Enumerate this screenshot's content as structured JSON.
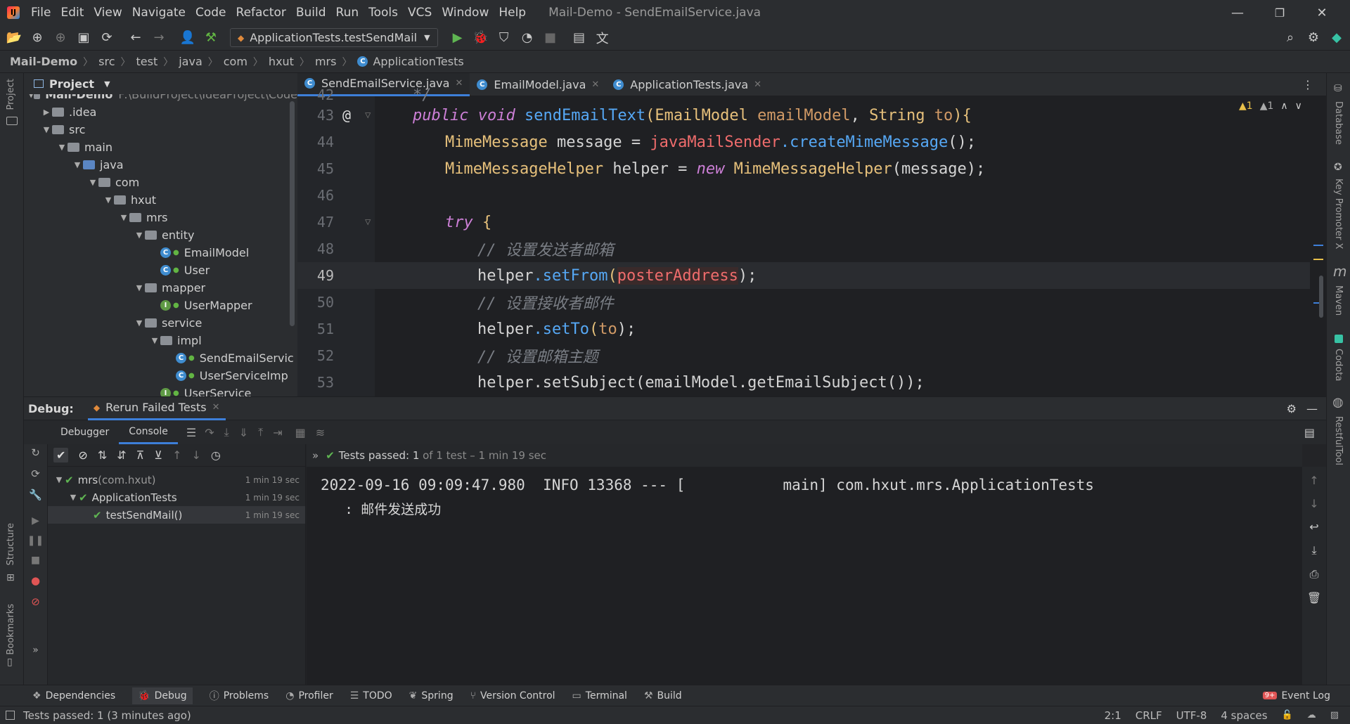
{
  "menu": {
    "items": [
      "File",
      "Edit",
      "View",
      "Navigate",
      "Code",
      "Refactor",
      "Build",
      "Run",
      "Tools",
      "VCS",
      "Window",
      "Help"
    ],
    "window_title": "Mail-Demo - SendEmailService.java"
  },
  "toolbar": {
    "run_config": "ApplicationTests.testSendMail"
  },
  "breadcrumb": [
    "Mail-Demo",
    "src",
    "test",
    "java",
    "com",
    "hxut",
    "mrs",
    "ApplicationTests"
  ],
  "left_strip": {
    "project": "Project",
    "structure": "Structure",
    "bookmarks": "Bookmarks"
  },
  "right_strip": {
    "database": "Database",
    "key_promoter": "Key Promoter X",
    "maven": "Maven",
    "codota": "Codota",
    "restful": "RestfulTool"
  },
  "project": {
    "header": "Project",
    "root_name": "Mail-Demo",
    "root_path": "F:\\BuildProject\\IdeaProject\\Code",
    "tree": [
      {
        "label": ".idea"
      },
      {
        "label": "src"
      },
      {
        "label": "main"
      },
      {
        "label": "java"
      },
      {
        "label": "com"
      },
      {
        "label": "hxut"
      },
      {
        "label": "mrs"
      },
      {
        "label": "entity"
      },
      {
        "label": "EmailModel"
      },
      {
        "label": "User"
      },
      {
        "label": "mapper"
      },
      {
        "label": "UserMapper"
      },
      {
        "label": "service"
      },
      {
        "label": "impl"
      },
      {
        "label": "SendEmailServic"
      },
      {
        "label": "UserServiceImp"
      },
      {
        "label": "UserService"
      }
    ]
  },
  "editor": {
    "tabs": [
      "SendEmailService.java",
      "EmailModel.java",
      "ApplicationTests.java"
    ],
    "warnings": "▲1",
    "weak_warnings": "▲1",
    "line_numbers": [
      "42",
      "43",
      "44",
      "45",
      "46",
      "47",
      "48",
      "49",
      "50",
      "51",
      "52",
      "53"
    ],
    "lines": {
      "l42": "*/",
      "l43": {
        "kw1": "public",
        "kw2": "void",
        "fn": "sendEmailText",
        "p1": "(",
        "t1": "EmailModel",
        "v1": " emailModel",
        "c1": ", ",
        "t2": "String",
        "v2": " to",
        "p2": "){"
      },
      "l44": {
        "t": "MimeMessage",
        "v": " message = ",
        "f": "javaMailSender",
        "m": ".createMimeMessage",
        "e": "();"
      },
      "l45": {
        "t": "MimeMessageHelper",
        "v": " helper = ",
        "k": "new",
        "t2": " MimeMessageHelper",
        "e": "(message);"
      },
      "l47": {
        "k": "try",
        "e": " {"
      },
      "l48": "// 设置发送者邮箱",
      "l49": {
        "a": "helper",
        "m": ".setFrom",
        "p": "(",
        "arg": "posterAddress",
        "e": ");"
      },
      "l50": "// 设置接收者邮件",
      "l51": {
        "a": "helper",
        "m": ".setTo",
        "p": "(",
        "arg": "to",
        "e": ");"
      },
      "l52": "// 设置邮箱主题",
      "l53": "helper.setSubject(emailModel.getEmailSubject());"
    }
  },
  "debug": {
    "title": "Debug:",
    "session": "Rerun Failed Tests",
    "tabs": [
      "Debugger",
      "Console"
    ],
    "status_prefix": "Tests passed: ",
    "status_count": "1",
    "status_rest": " of 1 test – 1 min 19 sec",
    "tests": [
      {
        "name": "mrs",
        "pkg": " (com.hxut)",
        "time": "1 min 19 sec"
      },
      {
        "name": "ApplicationTests",
        "time": "1 min 19 sec"
      },
      {
        "name": "testSendMail()",
        "time": "1 min 19 sec"
      }
    ],
    "console": [
      "2022-09-16 09:09:47.980  INFO 13368 --- [           main] com.hxut.mrs.ApplicationTests",
      "   : 邮件发送成功"
    ]
  },
  "bottom_tools": [
    "Dependencies",
    "Debug",
    "Problems",
    "Profiler",
    "TODO",
    "Spring",
    "Version Control",
    "Terminal",
    "Build"
  ],
  "event_log": "Event Log",
  "event_badge": "9+",
  "status": {
    "message": "Tests passed: 1 (3 minutes ago)",
    "position": "2:1",
    "line_sep": "CRLF",
    "encoding": "UTF-8",
    "indent": "4 spaces"
  }
}
